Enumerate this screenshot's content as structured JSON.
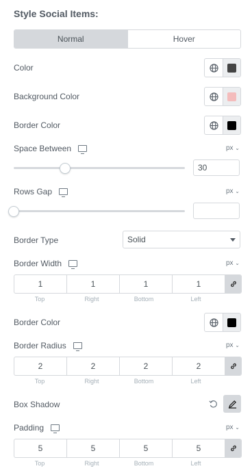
{
  "section_title": "Style Social Items:",
  "tabs": [
    {
      "label": "Normal",
      "active": true
    },
    {
      "label": "Hover",
      "active": false
    }
  ],
  "color": {
    "label": "Color",
    "swatch": "#444444"
  },
  "background_color": {
    "label": "Background Color",
    "swatch": "#f4bcbc"
  },
  "border_color": {
    "label": "Border Color",
    "swatch": "#000000"
  },
  "space_between": {
    "label": "Space Between",
    "unit": "px",
    "value": "30",
    "slider_value": 30
  },
  "rows_gap": {
    "label": "Rows Gap",
    "unit": "px",
    "value": "",
    "slider_value": 0
  },
  "border_type": {
    "label": "Border Type",
    "value": "Solid"
  },
  "border_width": {
    "label": "Border Width",
    "unit": "px",
    "top": "1",
    "right": "1",
    "bottom": "1",
    "left": "1"
  },
  "border_color_2": {
    "label": "Border Color",
    "swatch": "#000000"
  },
  "border_radius": {
    "label": "Border Radius",
    "unit": "px",
    "top": "2",
    "right": "2",
    "bottom": "2",
    "left": "2"
  },
  "box_shadow": {
    "label": "Box Shadow"
  },
  "padding": {
    "label": "Padding",
    "unit": "px",
    "top": "5",
    "right": "5",
    "bottom": "5",
    "left": "5"
  },
  "dim_labels": {
    "top": "Top",
    "right": "Right",
    "bottom": "Bottom",
    "left": "Left"
  },
  "icons": {
    "global": "globe-icon",
    "device": "desktop-icon",
    "link": "link-icon",
    "reset": "reset-icon",
    "edit": "pencil-icon",
    "caret": "chevron-down-icon"
  }
}
